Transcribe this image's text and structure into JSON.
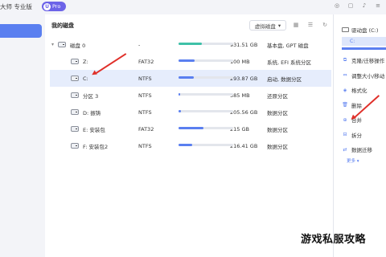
{
  "titlebar": {
    "app_title": "大师 专业版",
    "pro_badge_letter": "U",
    "pro_badge_label": "Pro"
  },
  "main": {
    "title": "我的磁盘",
    "virtual_disk_button": "虚拟磁盘",
    "rows": [
      {
        "name": "磁盘 0",
        "fs": "-",
        "usage": 0.42,
        "bar_color": "#3ec1a8",
        "size": "931.51 GB",
        "desc": "基本盘, GPT 磁盘",
        "selected": false
      },
      {
        "name": "Z:",
        "fs": "FAT32",
        "usage": 0.3,
        "bar_color": "#5a7ff0",
        "size": "100 MB",
        "desc": "系统, EFI 系统分区",
        "selected": false
      },
      {
        "name": "C:",
        "fs": "NTFS",
        "usage": 0.28,
        "bar_color": "#5a7ff0",
        "size": "293.87 GB",
        "desc": "启动, 数据分区",
        "selected": true
      },
      {
        "name": "分区 3",
        "fs": "NTFS",
        "usage": 0.03,
        "bar_color": "#5a7ff0",
        "size": "585 MB",
        "desc": "还原分区",
        "selected": false
      },
      {
        "name": "D: 振铸",
        "fs": "NTFS",
        "usage": 0.05,
        "bar_color": "#5a7ff0",
        "size": "205.56 GB",
        "desc": "数据分区",
        "selected": false
      },
      {
        "name": "E: 安装包",
        "fs": "FAT32",
        "usage": 0.45,
        "bar_color": "#5a7ff0",
        "size": "215 GB",
        "desc": "数据分区",
        "selected": false
      },
      {
        "name": "F: 安装包2",
        "fs": "NTFS",
        "usage": 0.25,
        "bar_color": "#5a7ff0",
        "size": "216.41 GB",
        "desc": "数据分区",
        "selected": false
      }
    ]
  },
  "right_panel": {
    "disk_label": "驱动盘 (C:)",
    "field_text": "C:",
    "operations": [
      {
        "label": "克隆/迁移操作",
        "icon": "clone-icon"
      },
      {
        "label": "调整大小/移动",
        "icon": "resize-icon"
      },
      {
        "label": "格式化",
        "icon": "format-icon"
      },
      {
        "label": "删除",
        "icon": "delete-icon"
      },
      {
        "label": "合并",
        "icon": "merge-icon"
      },
      {
        "label": "拆分",
        "icon": "split-icon"
      },
      {
        "label": "数据迁移",
        "icon": "migrate-icon"
      }
    ],
    "more_label": "更多 ▾"
  },
  "watermark": "游戏私服攻略"
}
